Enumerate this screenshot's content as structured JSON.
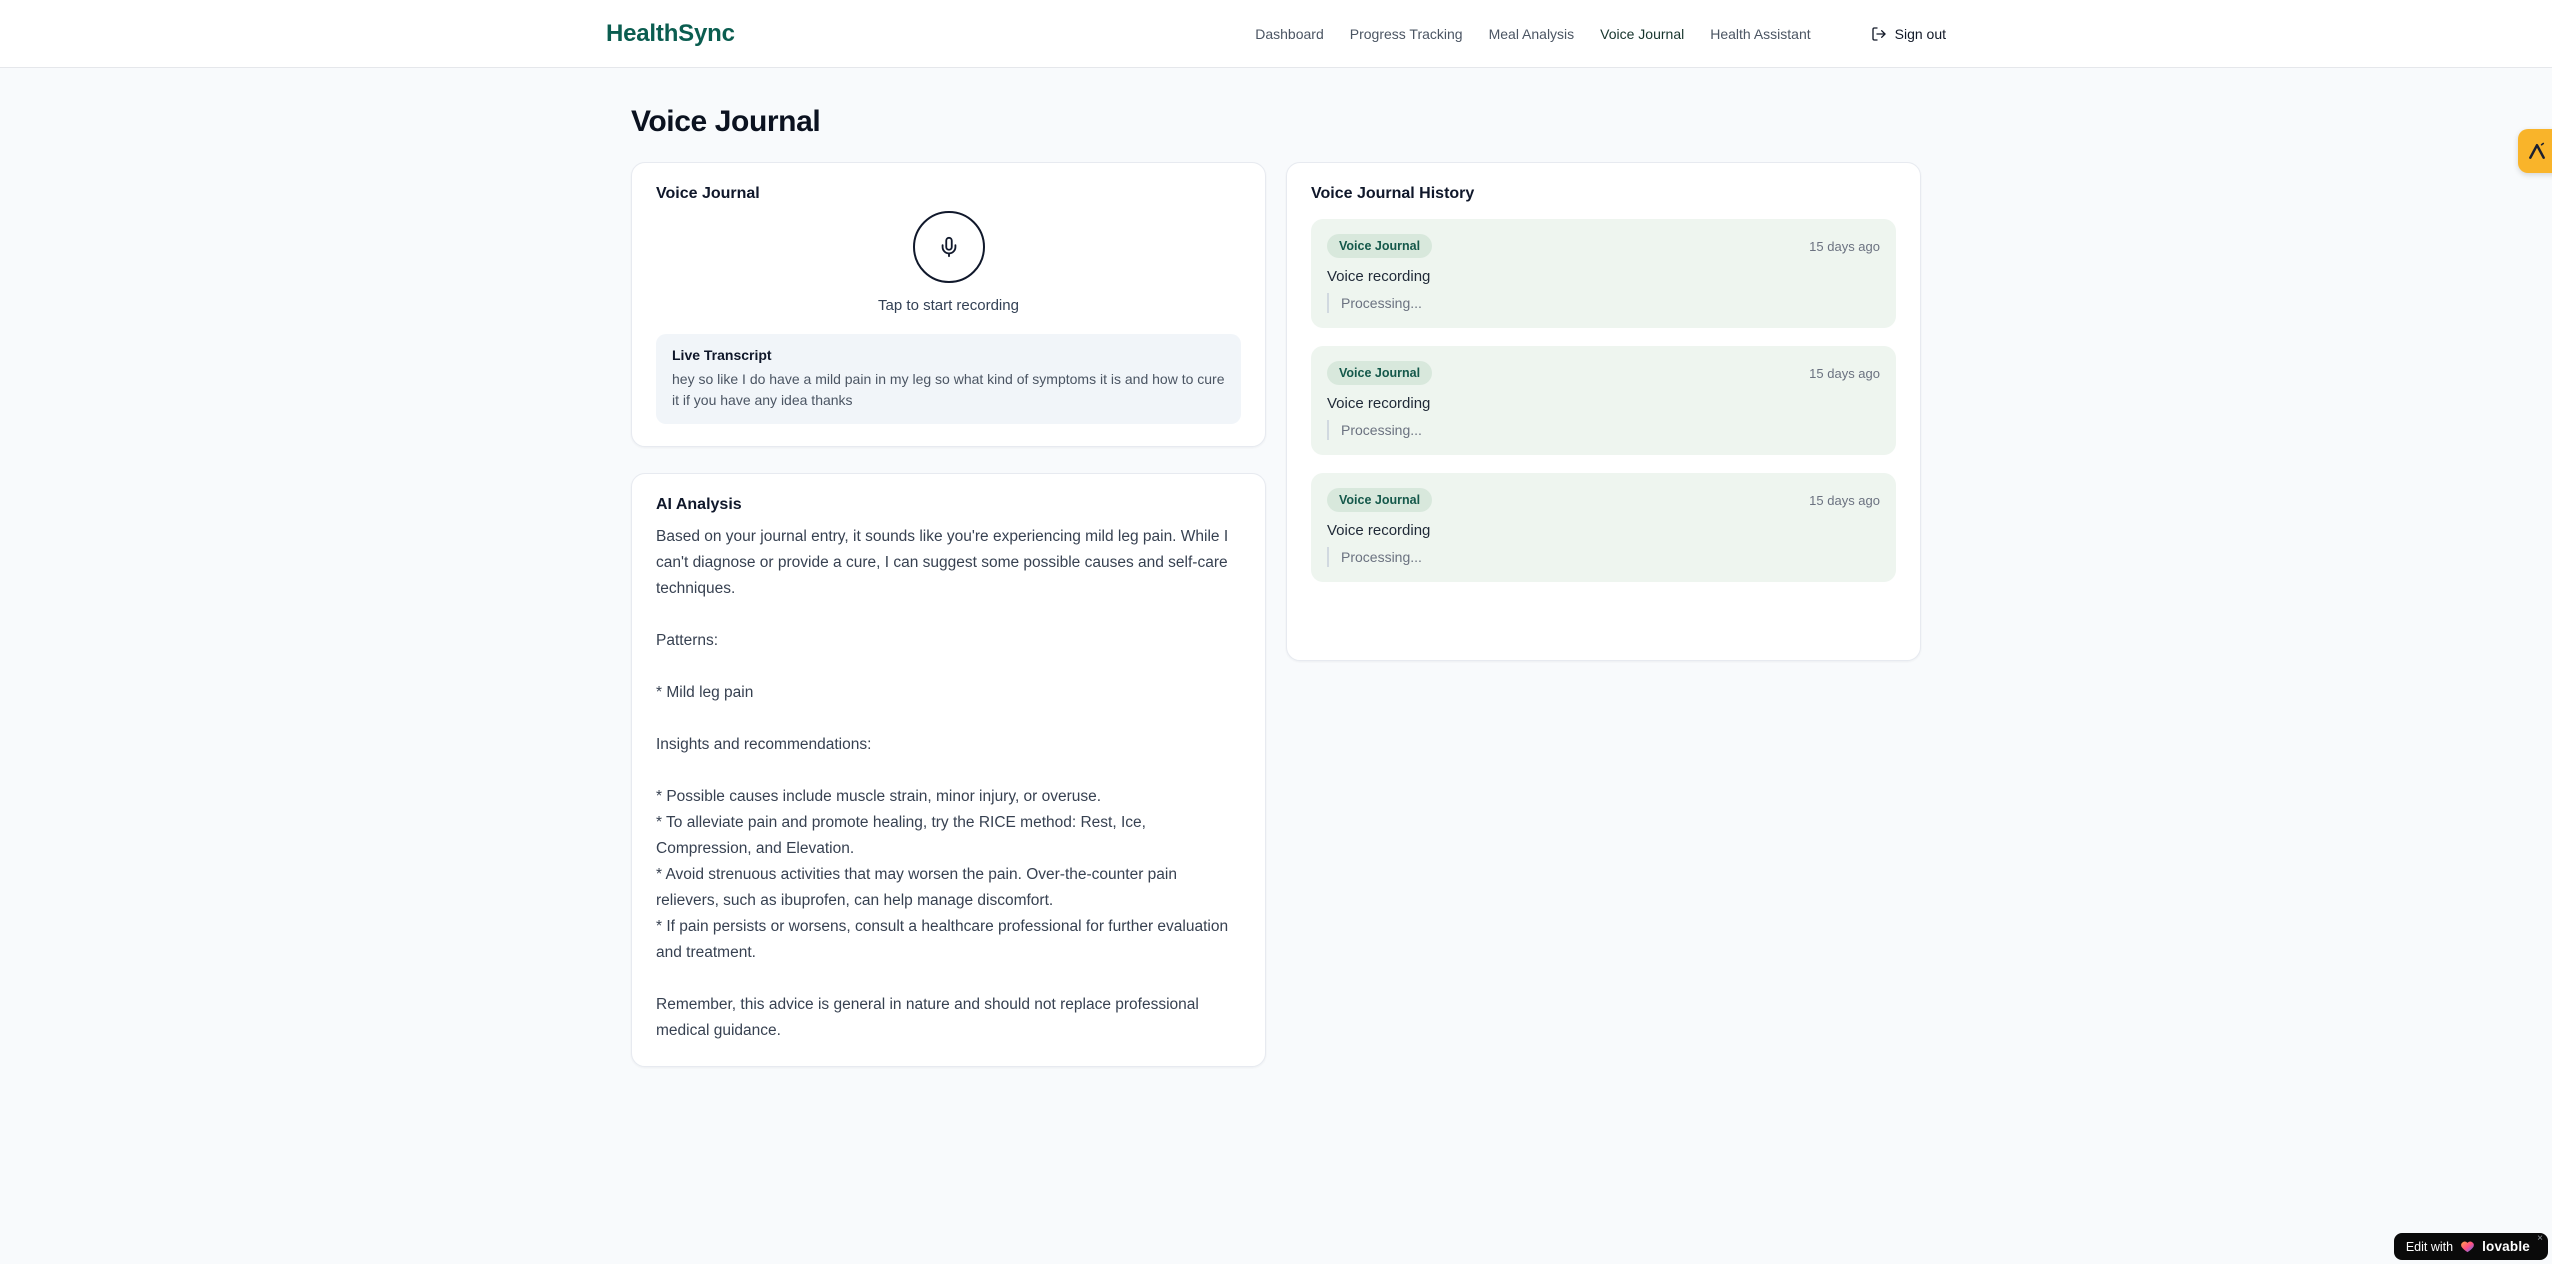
{
  "brand": {
    "name": "HealthSync"
  },
  "nav": {
    "items": [
      {
        "label": "Dashboard",
        "active": false
      },
      {
        "label": "Progress Tracking",
        "active": false
      },
      {
        "label": "Meal Analysis",
        "active": false
      },
      {
        "label": "Voice Journal",
        "active": true
      },
      {
        "label": "Health Assistant",
        "active": false
      }
    ],
    "sign_out_label": "Sign out"
  },
  "page": {
    "title": "Voice Journal"
  },
  "recorder_card": {
    "title": "Voice Journal",
    "tap_hint": "Tap to start recording",
    "transcript_title": "Live Transcript",
    "transcript_text": "hey so like I do have a mild pain in my leg so what kind of symptoms it is and how to cure it if you have any idea thanks"
  },
  "ai_card": {
    "title": "AI Analysis",
    "body": "Based on your journal entry, it sounds like you're experiencing mild leg pain. While I can't diagnose or provide a cure, I can suggest some possible causes and self-care techniques.\n\nPatterns:\n\n* Mild leg pain\n\nInsights and recommendations:\n\n* Possible causes include muscle strain, minor injury, or overuse.\n* To alleviate pain and promote healing, try the RICE method: Rest, Ice, Compression, and Elevation.\n* Avoid strenuous activities that may worsen the pain. Over-the-counter pain relievers, such as ibuprofen, can help manage discomfort.\n* If pain persists or worsens, consult a healthcare professional for further evaluation and treatment.\n\nRemember, this advice is general in nature and should not replace professional medical guidance."
  },
  "history_card": {
    "title": "Voice Journal History",
    "entries": [
      {
        "badge": "Voice Journal",
        "time": "15 days ago",
        "title": "Voice recording",
        "status": "Processing..."
      },
      {
        "badge": "Voice Journal",
        "time": "15 days ago",
        "title": "Voice recording",
        "status": "Processing..."
      },
      {
        "badge": "Voice Journal",
        "time": "15 days ago",
        "title": "Voice recording",
        "status": "Processing..."
      }
    ]
  },
  "floating": {
    "edit_prefix": "Edit with",
    "edit_brand": "lovable",
    "close_glyph": "×"
  },
  "colors": {
    "brand_teal": "#0b5d50",
    "page_bg": "#f8fafc",
    "entry_bg": "#eef5ef",
    "badge_bg": "#d8e8dc",
    "badge_text": "#14584a",
    "side_badge_orange": "#f9b42a",
    "pill_bg": "#0a0a0a"
  }
}
